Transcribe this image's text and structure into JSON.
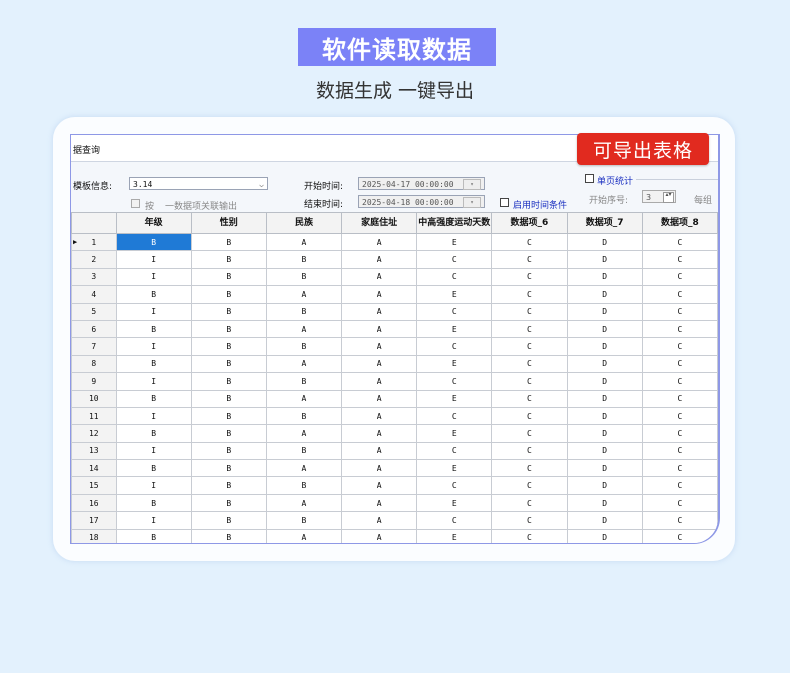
{
  "header": {
    "title": "软件读取数据",
    "subtitle": "数据生成 一键导出"
  },
  "export_button": "可导出表格",
  "window": {
    "title": "据查询",
    "template_label": "模板信息:",
    "template_value": "3.14",
    "checkbox_label": "按",
    "checkbox_label2": "一数据项关联输出",
    "start_time_label": "开始时间:",
    "start_time_value": "2025-04-17 00:00:00",
    "end_time_label": "结束时间:",
    "end_time_value": "2025-04-18 00:00:00",
    "enable_time_label": "启用时间条件",
    "page_stats_label": "单页统计",
    "start_seq_label": "开始序号:",
    "start_seq_value": "3",
    "per_group_label": "每组"
  },
  "table": {
    "columns": [
      "年级",
      "性别",
      "民族",
      "家庭住址",
      "中高强度运动天数",
      "数据项_6",
      "数据项_7",
      "数据项_8"
    ],
    "rows": [
      {
        "n": "1",
        "cells": [
          "B",
          "B",
          "A",
          "A",
          "E",
          "C",
          "D",
          "C"
        ]
      },
      {
        "n": "2",
        "cells": [
          "I",
          "B",
          "B",
          "A",
          "C",
          "C",
          "D",
          "C"
        ]
      },
      {
        "n": "3",
        "cells": [
          "I",
          "B",
          "B",
          "A",
          "C",
          "C",
          "D",
          "C"
        ]
      },
      {
        "n": "4",
        "cells": [
          "B",
          "B",
          "A",
          "A",
          "E",
          "C",
          "D",
          "C"
        ]
      },
      {
        "n": "5",
        "cells": [
          "I",
          "B",
          "B",
          "A",
          "C",
          "C",
          "D",
          "C"
        ]
      },
      {
        "n": "6",
        "cells": [
          "B",
          "B",
          "A",
          "A",
          "E",
          "C",
          "D",
          "C"
        ]
      },
      {
        "n": "7",
        "cells": [
          "I",
          "B",
          "B",
          "A",
          "C",
          "C",
          "D",
          "C"
        ]
      },
      {
        "n": "8",
        "cells": [
          "B",
          "B",
          "A",
          "A",
          "E",
          "C",
          "D",
          "C"
        ]
      },
      {
        "n": "9",
        "cells": [
          "I",
          "B",
          "B",
          "A",
          "C",
          "C",
          "D",
          "C"
        ]
      },
      {
        "n": "10",
        "cells": [
          "B",
          "B",
          "A",
          "A",
          "E",
          "C",
          "D",
          "C"
        ]
      },
      {
        "n": "11",
        "cells": [
          "I",
          "B",
          "B",
          "A",
          "C",
          "C",
          "D",
          "C"
        ]
      },
      {
        "n": "12",
        "cells": [
          "B",
          "B",
          "A",
          "A",
          "E",
          "C",
          "D",
          "C"
        ]
      },
      {
        "n": "13",
        "cells": [
          "I",
          "B",
          "B",
          "A",
          "C",
          "C",
          "D",
          "C"
        ]
      },
      {
        "n": "14",
        "cells": [
          "B",
          "B",
          "A",
          "A",
          "E",
          "C",
          "D",
          "C"
        ]
      },
      {
        "n": "15",
        "cells": [
          "I",
          "B",
          "B",
          "A",
          "C",
          "C",
          "D",
          "C"
        ]
      },
      {
        "n": "16",
        "cells": [
          "B",
          "B",
          "A",
          "A",
          "E",
          "C",
          "D",
          "C"
        ]
      },
      {
        "n": "17",
        "cells": [
          "I",
          "B",
          "B",
          "A",
          "C",
          "C",
          "D",
          "C"
        ]
      },
      {
        "n": "18",
        "cells": [
          "B",
          "B",
          "A",
          "A",
          "E",
          "C",
          "D",
          "C"
        ]
      }
    ]
  },
  "colors": {
    "title_badge": "#7b82f7",
    "export_button": "#e12a1f",
    "selection": "#1f7ad6",
    "background": "#e3f1fd"
  }
}
